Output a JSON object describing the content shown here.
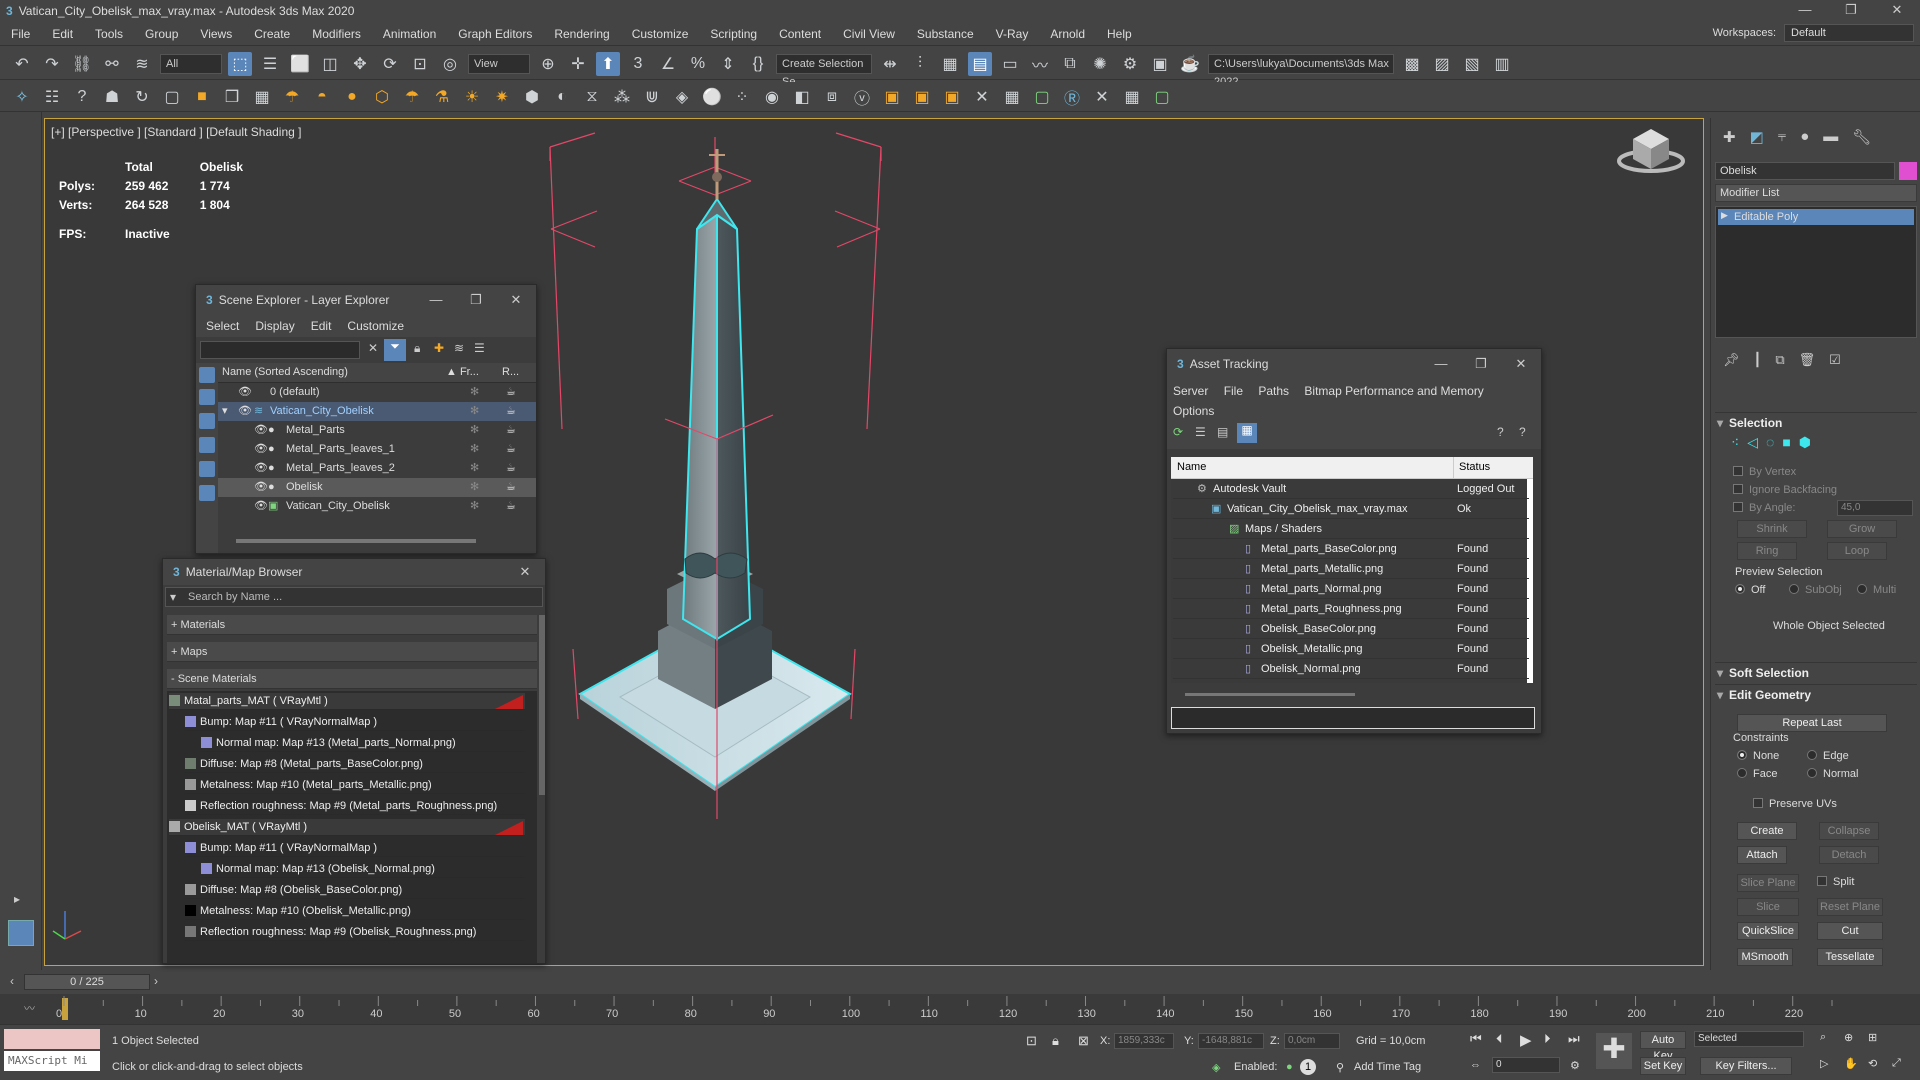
{
  "title": "Vatican_City_Obelisk_max_vray.max - Autodesk 3ds Max 2020",
  "window_controls": [
    "—",
    "❐",
    "✕"
  ],
  "menu": [
    "File",
    "Edit",
    "Tools",
    "Group",
    "Views",
    "Create",
    "Modifiers",
    "Animation",
    "Graph Editors",
    "Rendering",
    "Customize",
    "Scripting",
    "Content",
    "Civil View",
    "Substance",
    "V-Ray",
    "Arnold",
    "Help"
  ],
  "workspace_label": "Workspaces:",
  "workspace_value": "Default",
  "toolbar": {
    "selection_filter": "All",
    "ref_coord": "View",
    "named_selection": "Create Selection Se",
    "project_path": "C:\\Users\\lukya\\Documents\\3ds Max 2022"
  },
  "viewport": {
    "label": "[+] [Perspective ] [Standard ] [Default Shading ]",
    "stats_total_header": "Total",
    "stats_sel_header": "Obelisk",
    "polys_label": "Polys:",
    "polys_total": "259 462",
    "polys_sel": "1 774",
    "verts_label": "Verts:",
    "verts_total": "264 528",
    "verts_sel": "1 804",
    "fps_label": "FPS:",
    "fps_value": "Inactive",
    "selection_color": "#3ee6ee"
  },
  "scene_explorer": {
    "title": "Scene Explorer - Layer Explorer",
    "menu": [
      "Select",
      "Display",
      "Edit",
      "Customize"
    ],
    "col_name": "Name (Sorted Ascending)",
    "col_fr": "▲ Fr...",
    "col_r": "R...",
    "rows": [
      {
        "label": "0 (default)",
        "indent": 0
      },
      {
        "label": "Vatican_City_Obelisk",
        "indent": 0
      },
      {
        "label": "Metal_Parts",
        "indent": 1
      },
      {
        "label": "Metal_Parts_leaves_1",
        "indent": 1
      },
      {
        "label": "Metal_Parts_leaves_2",
        "indent": 1
      },
      {
        "label": "Obelisk",
        "indent": 1
      },
      {
        "label": "Vatican_City_Obelisk",
        "indent": 1
      }
    ]
  },
  "material_browser": {
    "title": "Material/Map Browser",
    "search_placeholder": "Search by Name ...",
    "sections": [
      "+ Materials",
      "+ Maps",
      "- Scene Materials"
    ],
    "items": [
      {
        "label": "Matal_parts_MAT  ( VRayMtl )",
        "level": 0
      },
      {
        "label": "Bump: Map #11  ( VRayNormalMap )",
        "level": 1
      },
      {
        "label": "Normal map: Map #13 (Metal_parts_Normal.png)",
        "level": 2
      },
      {
        "label": "Diffuse: Map #8 (Metal_parts_BaseColor.png)",
        "level": 1
      },
      {
        "label": "Metalness: Map #10 (Metal_parts_Metallic.png)",
        "level": 1
      },
      {
        "label": "Reflection roughness: Map #9 (Metal_parts_Roughness.png)",
        "level": 1
      },
      {
        "label": "Obelisk_MAT  ( VRayMtl )",
        "level": 0
      },
      {
        "label": "Bump: Map #11  ( VRayNormalMap )",
        "level": 1
      },
      {
        "label": "Normal map: Map #13 (Obelisk_Normal.png)",
        "level": 2
      },
      {
        "label": "Diffuse: Map #8 (Obelisk_BaseColor.png)",
        "level": 1
      },
      {
        "label": "Metalness: Map #10 (Obelisk_Metallic.png)",
        "level": 1
      },
      {
        "label": "Reflection roughness: Map #9 (Obelisk_Roughness.png)",
        "level": 1
      }
    ]
  },
  "asset_tracking": {
    "title": "Asset Tracking",
    "menu": [
      "Server",
      "File",
      "Paths",
      "Bitmap Performance and Memory"
    ],
    "menu2": "Options",
    "col_name": "Name",
    "col_status": "Status",
    "rows": [
      {
        "name": "Autodesk Vault",
        "status": "Logged Out",
        "indent": 1
      },
      {
        "name": "Vatican_City_Obelisk_max_vray.max",
        "status": "Ok",
        "indent": 2
      },
      {
        "name": "Maps / Shaders",
        "status": "",
        "indent": 3
      },
      {
        "name": "Metal_parts_BaseColor.png",
        "status": "Found",
        "indent": 4
      },
      {
        "name": "Metal_parts_Metallic.png",
        "status": "Found",
        "indent": 4
      },
      {
        "name": "Metal_parts_Normal.png",
        "status": "Found",
        "indent": 4
      },
      {
        "name": "Metal_parts_Roughness.png",
        "status": "Found",
        "indent": 4
      },
      {
        "name": "Obelisk_BaseColor.png",
        "status": "Found",
        "indent": 4
      },
      {
        "name": "Obelisk_Metallic.png",
        "status": "Found",
        "indent": 4
      },
      {
        "name": "Obelisk_Normal.png",
        "status": "Found",
        "indent": 4
      }
    ]
  },
  "command_panel": {
    "object_name": "Obelisk",
    "modifier_list": "Modifier List",
    "stack_item": "Editable Poly",
    "selection_header": "Selection",
    "by_vertex": "By Vertex",
    "ignore_backfacing": "Ignore Backfacing",
    "by_angle": "By Angle:",
    "by_angle_value": "45,0",
    "shrink": "Shrink",
    "grow": "Grow",
    "ring": "Ring",
    "loop": "Loop",
    "preview_selection": "Preview Selection",
    "preview_off": "Off",
    "preview_subobj": "SubObj",
    "preview_multi": "Multi",
    "whole_object": "Whole Object Selected",
    "soft_selection": "Soft Selection",
    "edit_geometry": "Edit Geometry",
    "repeat_last": "Repeat Last",
    "constraints": "Constraints",
    "c_none": "None",
    "c_edge": "Edge",
    "c_face": "Face",
    "c_normal": "Normal",
    "preserve_uvs": "Preserve UVs",
    "create": "Create",
    "collapse": "Collapse",
    "attach": "Attach",
    "detach": "Detach",
    "slice_plane": "Slice Plane",
    "split": "Split",
    "slice": "Slice",
    "reset_plane": "Reset Plane",
    "quickslice": "QuickSlice",
    "cut": "Cut",
    "msmooth": "MSmooth",
    "tessellate": "Tessellate"
  },
  "timeline": {
    "frame": "0 / 225",
    "ticks": [
      "0",
      "10",
      "20",
      "30",
      "40",
      "50",
      "60",
      "70",
      "80",
      "90",
      "100",
      "110",
      "120",
      "130",
      "140",
      "150",
      "160",
      "170",
      "180",
      "190",
      "200",
      "210",
      "220"
    ]
  },
  "status": {
    "script_label": "MAXScript Mi",
    "selected": "1 Object Selected",
    "prompt": "Click or click-and-drag to select objects",
    "x_label": "X:",
    "x_val": "1859,333c",
    "y_label": "Y:",
    "y_val": "-1648,881c",
    "z_label": "Z:",
    "z_val": "0,0cm",
    "grid": "Grid = 10,0cm",
    "enabled": "Enabled:",
    "add_time_tag": "Add Time Tag",
    "auto_key": "Auto Key",
    "set_key": "Set Key",
    "key_mode": "Selected",
    "key_filters": "Key Filters...",
    "frame_field": "0"
  }
}
